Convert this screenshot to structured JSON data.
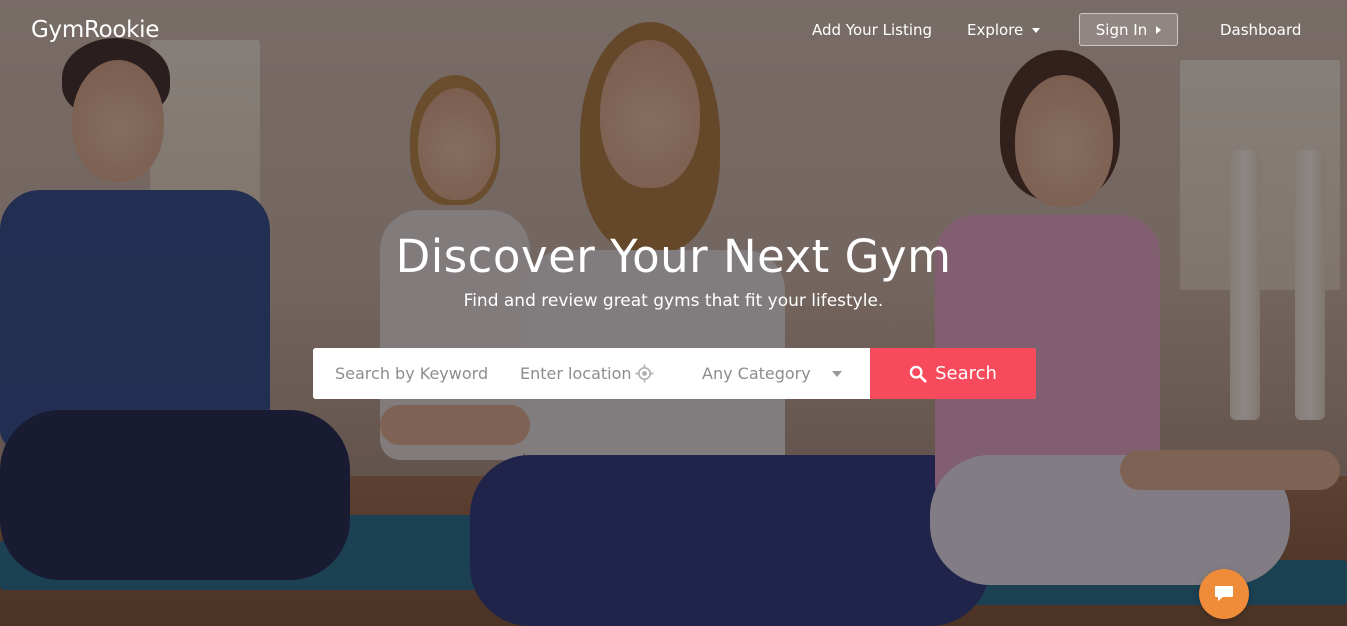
{
  "brand": {
    "name": "GymRookie"
  },
  "nav": {
    "add_listing": "Add Your Listing",
    "explore": "Explore",
    "sign_in": "Sign In",
    "dashboard": "Dashboard"
  },
  "hero": {
    "title": "Discover Your Next Gym",
    "subtitle": "Find and review great gyms that fit your lifestyle."
  },
  "search": {
    "keyword_placeholder": "Search by Keyword",
    "location_placeholder": "Enter location",
    "category_selected": "Any Category",
    "button_label": "Search"
  },
  "colors": {
    "accent": "#f84a5d",
    "chat": "#ef8c3a"
  },
  "icons": {
    "locate": "crosshair-locate-icon",
    "search": "magnifier-icon",
    "chat": "speech-bubble-icon"
  }
}
